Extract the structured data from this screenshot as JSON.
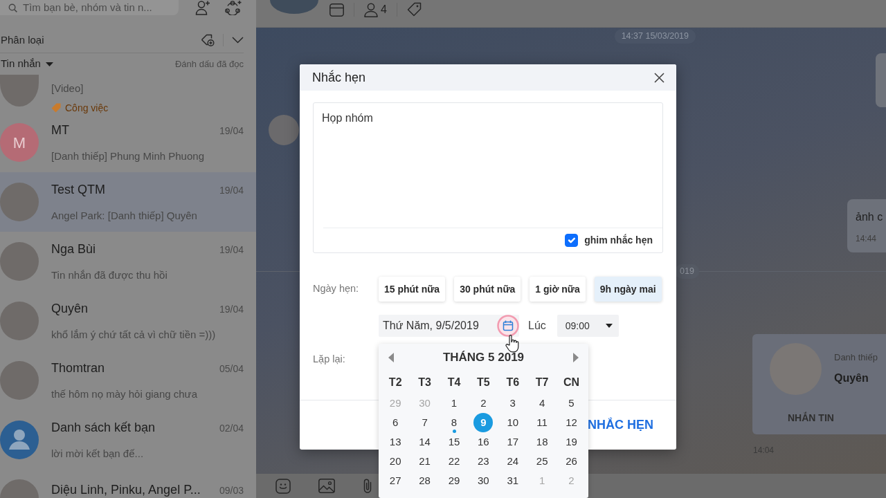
{
  "sidebar": {
    "search": {
      "placeholder": "Tìm bạn bè, nhóm và tin n..."
    },
    "filter": {
      "label": "Phân loại"
    },
    "list_header": {
      "title": "Tin nhắn",
      "action": "Đánh dấu đã đọc"
    },
    "conversations": [
      {
        "avatar": {
          "kind": "photo"
        },
        "preview": "[Video]",
        "tag": {
          "label": "Công việc",
          "color": "#c97b2c"
        },
        "selected": false
      },
      {
        "avatar": {
          "kind": "initial",
          "initial": "M"
        },
        "name": "MT",
        "date": "19/04",
        "preview": "[Danh thiếp] Phung Minh Phuong",
        "selected": false
      },
      {
        "avatar": {
          "kind": "photo"
        },
        "name": "Test QTM",
        "date": "19/04",
        "preview": "Angel Park: [Danh thiếp] Quyên",
        "selected": true
      },
      {
        "avatar": {
          "kind": "photo"
        },
        "name": "Nga Bùi",
        "date": "19/04",
        "preview": "Tin nhắn đã được thu hồi",
        "selected": false
      },
      {
        "avatar": {
          "kind": "photo"
        },
        "name": "Quyên",
        "date": "19/04",
        "preview": "khổ lắm ý chứ tất cả vì chữ tiền =)))",
        "selected": false
      },
      {
        "avatar": {
          "kind": "photo"
        },
        "name": "Thomtran",
        "date": "05/04",
        "preview": "thế hôm nọ mày hỏi giang chưa",
        "selected": false
      },
      {
        "avatar": {
          "kind": "icon"
        },
        "name": "Danh sách kết bạn",
        "date": "02/04",
        "preview": "lời mời kết bạn đế...",
        "selected": false
      },
      {
        "avatar": {
          "kind": "photo"
        },
        "name": "Diệu Linh, Pinku, Angel P...",
        "date": "09/03",
        "selected": false
      }
    ]
  },
  "chat": {
    "header": {
      "member_count": "4"
    },
    "items": [
      {
        "kind": "time",
        "text": "14:37 15/03/2019"
      },
      {
        "kind": "bubble-edge"
      },
      {
        "kind": "avatar"
      },
      {
        "kind": "outgoing",
        "text": "ảnh c",
        "time": "14:44"
      },
      {
        "kind": "separator",
        "text": "019"
      },
      {
        "kind": "contact-card",
        "label": "Danh thiếp",
        "name": "Quyên",
        "action": "NHẮN TIN"
      },
      {
        "kind": "note",
        "text": "14:04"
      }
    ]
  },
  "reminder": {
    "title": "Nhắc hẹn",
    "note": "Họp nhóm",
    "pinned": true,
    "pin_label": "ghim nhắc hẹn",
    "date_label": "Ngày hẹn:",
    "quick_options": [
      {
        "label": "15 phút nữa",
        "selected": false
      },
      {
        "label": "30 phút nữa",
        "selected": false
      },
      {
        "label": "1 giờ nữa",
        "selected": false
      },
      {
        "label": "9h ngày mai",
        "selected": true
      }
    ],
    "date": "Thứ Năm, 9/5/2019",
    "time_label": "Lúc",
    "time": "09:00",
    "repeat_label": "Lặp lại:",
    "submit": "NHẮC HẸN",
    "calendar": {
      "title": "THÁNG 5 2019",
      "weekdays": [
        "T2",
        "T3",
        "T4",
        "T5",
        "T6",
        "T7",
        "CN"
      ],
      "weeks": [
        {
          "days": [
            {
              "label": "29",
              "outside": true,
              "selected": false,
              "today": false
            },
            {
              "label": "30",
              "outside": true,
              "selected": false,
              "today": false
            },
            {
              "label": "1",
              "outside": false,
              "selected": false,
              "today": false
            },
            {
              "label": "2",
              "outside": false,
              "selected": false,
              "today": false
            },
            {
              "label": "3",
              "outside": false,
              "selected": false,
              "today": false
            },
            {
              "label": "4",
              "outside": false,
              "selected": false,
              "today": false
            },
            {
              "label": "5",
              "outside": false,
              "selected": false,
              "today": false
            }
          ]
        },
        {
          "days": [
            {
              "label": "6",
              "outside": false,
              "selected": false,
              "today": false
            },
            {
              "label": "7",
              "outside": false,
              "selected": false,
              "today": false
            },
            {
              "label": "8",
              "outside": false,
              "selected": false,
              "today": true
            },
            {
              "label": "9",
              "outside": false,
              "selected": true,
              "today": false
            },
            {
              "label": "10",
              "outside": false,
              "selected": false,
              "today": false
            },
            {
              "label": "11",
              "outside": false,
              "selected": false,
              "today": false
            },
            {
              "label": "12",
              "outside": false,
              "selected": false,
              "today": false
            }
          ]
        },
        {
          "days": [
            {
              "label": "13",
              "outside": false,
              "selected": false,
              "today": false
            },
            {
              "label": "14",
              "outside": false,
              "selected": false,
              "today": false
            },
            {
              "label": "15",
              "outside": false,
              "selected": false,
              "today": false
            },
            {
              "label": "16",
              "outside": false,
              "selected": false,
              "today": false
            },
            {
              "label": "17",
              "outside": false,
              "selected": false,
              "today": false
            },
            {
              "label": "18",
              "outside": false,
              "selected": false,
              "today": false
            },
            {
              "label": "19",
              "outside": false,
              "selected": false,
              "today": false
            }
          ]
        },
        {
          "days": [
            {
              "label": "20",
              "outside": false,
              "selected": false,
              "today": false
            },
            {
              "label": "21",
              "outside": false,
              "selected": false,
              "today": false
            },
            {
              "label": "22",
              "outside": false,
              "selected": false,
              "today": false
            },
            {
              "label": "23",
              "outside": false,
              "selected": false,
              "today": false
            },
            {
              "label": "24",
              "outside": false,
              "selected": false,
              "today": false
            },
            {
              "label": "25",
              "outside": false,
              "selected": false,
              "today": false
            },
            {
              "label": "26",
              "outside": false,
              "selected": false,
              "today": false
            }
          ]
        },
        {
          "days": [
            {
              "label": "27",
              "outside": false,
              "selected": false,
              "today": false
            },
            {
              "label": "28",
              "outside": false,
              "selected": false,
              "today": false
            },
            {
              "label": "29",
              "outside": false,
              "selected": false,
              "today": false
            },
            {
              "label": "30",
              "outside": false,
              "selected": false,
              "today": false
            },
            {
              "label": "31",
              "outside": false,
              "selected": false,
              "today": false
            },
            {
              "label": "1",
              "outside": true,
              "selected": false,
              "today": false
            },
            {
              "label": "2",
              "outside": true,
              "selected": false,
              "today": false
            }
          ]
        }
      ]
    }
  }
}
